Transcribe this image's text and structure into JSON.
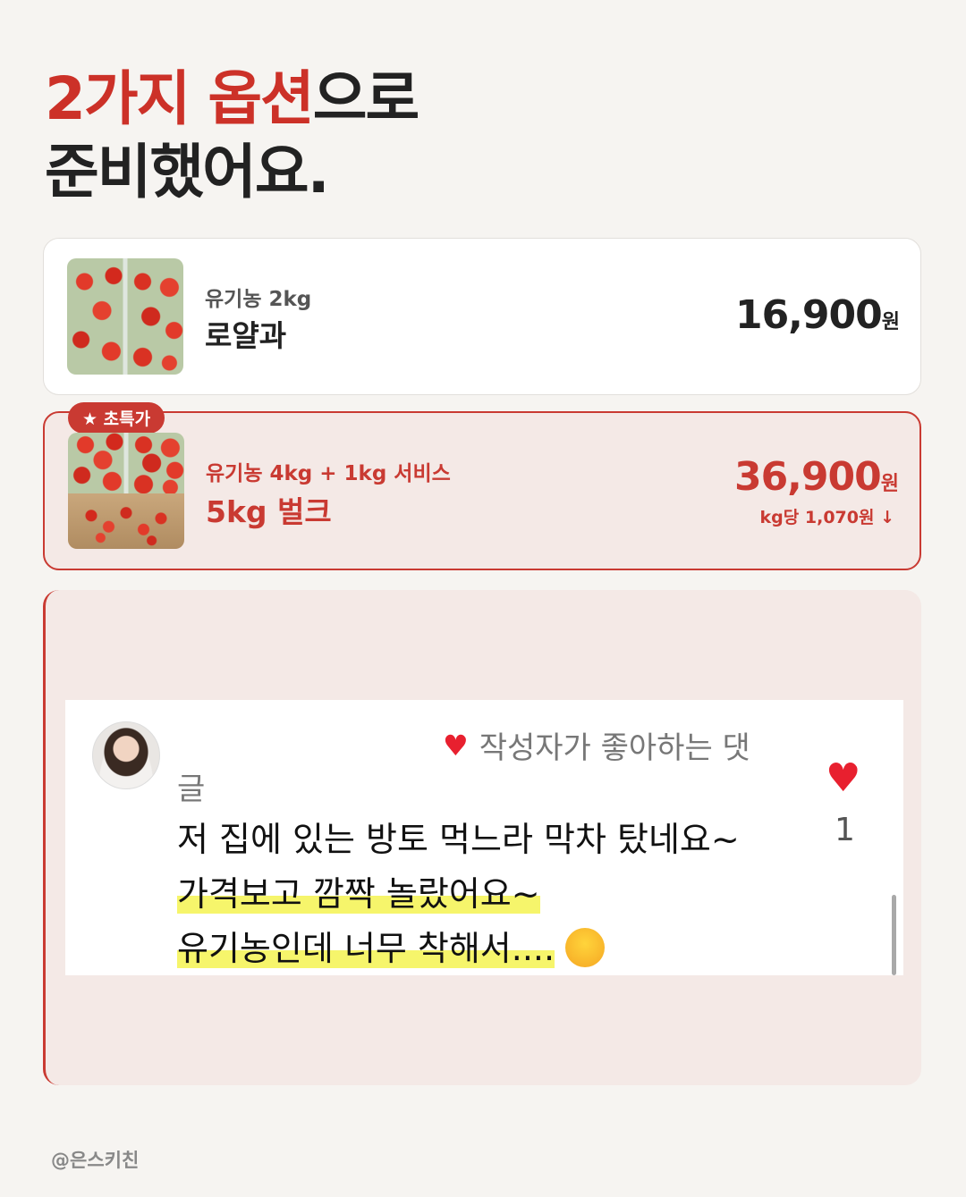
{
  "headline": {
    "line1_red": "2가지 옵션",
    "line1_black": "으로",
    "line2": "준비했어요."
  },
  "options": [
    {
      "sub": "유기농 2kg",
      "name": "로얄과",
      "price": "16,900",
      "currency": "원"
    },
    {
      "badge": "★ 초특가",
      "sub": "유기농 4kg + 1kg 서비스",
      "name": "5kg 벌크",
      "price": "36,900",
      "currency": "원",
      "per_kg": "kg당 1,070원 ↓"
    }
  ],
  "review": {
    "liked_label_1": "작성자가 좋아하는 댓",
    "liked_label_2": "글",
    "line1": "저 집에 있는 방토 먹느라 막차 탔네요~",
    "line2": "가격보고 깜짝 놀랐어요~",
    "line3": "유기농인데 너무 착해서....",
    "like_count": "1"
  },
  "footer": {
    "handle": "@은스키친"
  },
  "colors": {
    "accent": "#c93a32",
    "background": "#f6f4f1",
    "highlight": "#f6f56b",
    "heart": "#e8202f"
  },
  "icons": [
    "heart-icon",
    "heart-emoji-icon",
    "heart-eyes-emoji"
  ]
}
